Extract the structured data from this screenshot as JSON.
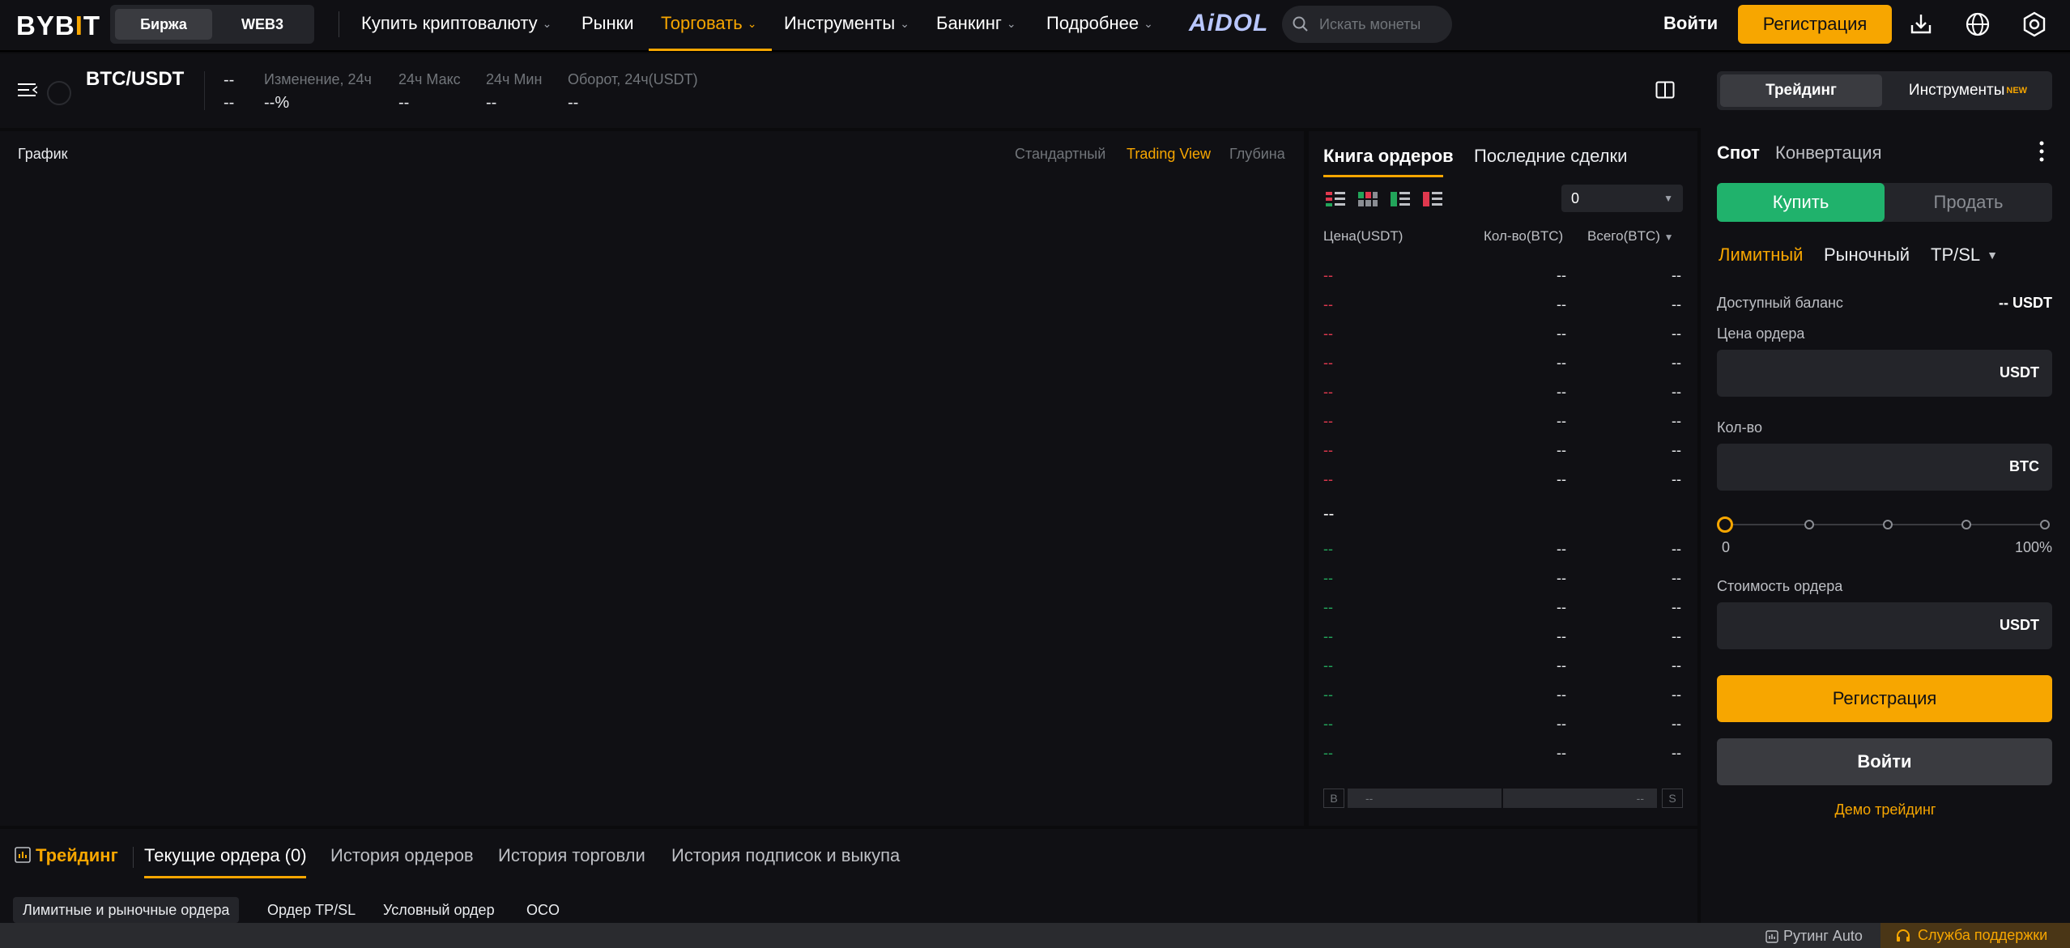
{
  "header": {
    "logo_main": "BYB",
    "logo_accent": "I",
    "logo_tail": "T",
    "seg": [
      "Биржа",
      "WEB3"
    ],
    "nav": [
      "Купить криптовалюту",
      "Рынки",
      "Торговать",
      "Инструменты",
      "Банкинг",
      "Подробнее"
    ],
    "aidol": "AiDOL",
    "search_placeholder": "Искать монеты",
    "login": "Войти",
    "register": "Регистрация"
  },
  "ticker": {
    "pair": "BTC/USDT",
    "price": "--",
    "price_sub": "--",
    "change_label": "Изменение, 24ч",
    "change_value": "--%",
    "high_label": "24ч Макс",
    "high_value": "--",
    "low_label": "24ч Мин",
    "low_value": "--",
    "turnover_label": "Оборот, 24ч(USDT)",
    "turnover_value": "--"
  },
  "chart": {
    "title": "График",
    "modes": [
      "Стандартный",
      "Trading View",
      "Глубина"
    ]
  },
  "orderbook": {
    "tabs": [
      "Книга ордеров",
      "Последние сделки"
    ],
    "precision": "0",
    "col_price": "Цена(USDT)",
    "col_qty": "Кол-во(BTC)",
    "col_total": "Всего(BTC)",
    "asks": [
      {
        "p": "--",
        "q": "--",
        "t": "--"
      },
      {
        "p": "--",
        "q": "--",
        "t": "--"
      },
      {
        "p": "--",
        "q": "--",
        "t": "--"
      },
      {
        "p": "--",
        "q": "--",
        "t": "--"
      },
      {
        "p": "--",
        "q": "--",
        "t": "--"
      },
      {
        "p": "--",
        "q": "--",
        "t": "--"
      },
      {
        "p": "--",
        "q": "--",
        "t": "--"
      },
      {
        "p": "--",
        "q": "--",
        "t": "--"
      }
    ],
    "mid": "--",
    "bids": [
      {
        "p": "--",
        "q": "--",
        "t": "--"
      },
      {
        "p": "--",
        "q": "--",
        "t": "--"
      },
      {
        "p": "--",
        "q": "--",
        "t": "--"
      },
      {
        "p": "--",
        "q": "--",
        "t": "--"
      },
      {
        "p": "--",
        "q": "--",
        "t": "--"
      },
      {
        "p": "--",
        "q": "--",
        "t": "--"
      },
      {
        "p": "--",
        "q": "--",
        "t": "--"
      },
      {
        "p": "--",
        "q": "--",
        "t": "--"
      }
    ],
    "ratio_b": "B",
    "ratio_s": "S",
    "ratio_left": "--",
    "ratio_right": "--"
  },
  "bottom": {
    "tabs": [
      "Трейдинг",
      "Текущие ордера (0)",
      "История ордеров",
      "История торговли",
      "История подписок и выкупа"
    ],
    "subtabs": [
      "Лимитные и рыночные ордера",
      "Ордер TP/SL",
      "Условный ордер",
      "OCO"
    ]
  },
  "status": {
    "routing": "Рутинг Auto",
    "support": "Служба поддержки"
  },
  "form": {
    "mode_on": "Трейдинг",
    "mode_off": "Инструменты",
    "mode_badge": "NEW",
    "tabs": [
      "Спот",
      "Конвертация"
    ],
    "buy": "Купить",
    "sell": "Продать",
    "order_types": [
      "Лимитный",
      "Рыночный",
      "TP/SL"
    ],
    "balance_label": "Доступный баланс",
    "balance_value": "-- USDT",
    "price_label": "Цена ордера",
    "price_unit": "USDT",
    "qty_label": "Кол-во",
    "qty_unit": "BTC",
    "slider_min": "0",
    "slider_max": "100%",
    "slider_value": 0,
    "cost_label": "Стоимость ордера",
    "cost_unit": "USDT",
    "register": "Регистрация",
    "login": "Войти",
    "demo": "Демо трейдинг"
  },
  "colors": {
    "accent": "#f7a600",
    "buy": "#20b26c",
    "ask": "#e0384e",
    "bid": "#22a55a"
  }
}
